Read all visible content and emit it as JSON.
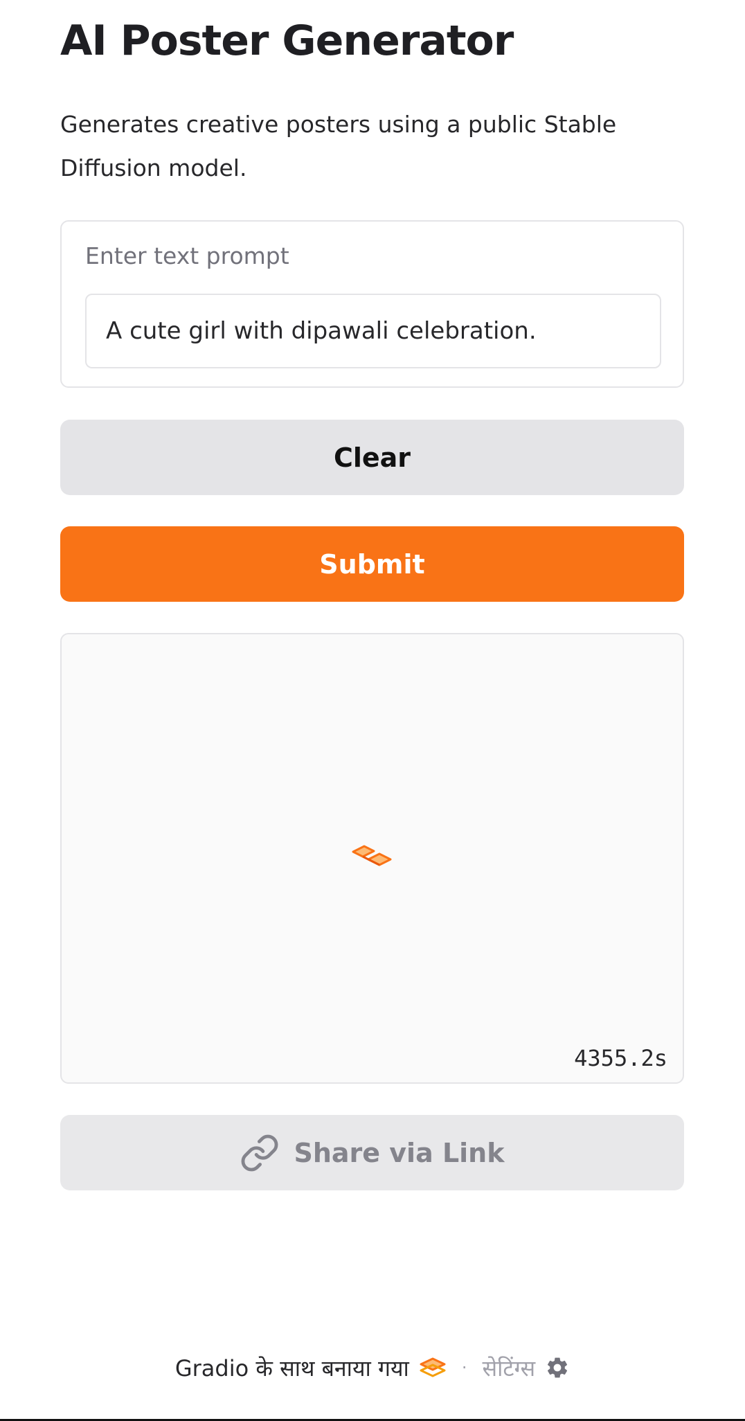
{
  "header": {
    "title": "AI Poster Generator",
    "description": "Generates creative posters using a public Stable Diffusion model."
  },
  "input": {
    "label": "Enter text prompt",
    "value": "A cute girl with dipawali celebration."
  },
  "buttons": {
    "clear_label": "Clear",
    "submit_label": "Submit",
    "share_label": "Share via Link"
  },
  "output": {
    "timer": "4355.2s",
    "loading_icon": "gradio-loader-icon"
  },
  "footer": {
    "made_with": "Gradio के साथ बनाया गया",
    "separator": "·",
    "settings_label": "सेटिंग्स",
    "logo_icon": "gradio-logo-icon",
    "settings_icon": "gear-icon"
  },
  "colors": {
    "accent": "#f97316",
    "secondary_button": "#e4e4e7",
    "share_button": "#e8e8ea",
    "panel_background": "#fafafa"
  }
}
